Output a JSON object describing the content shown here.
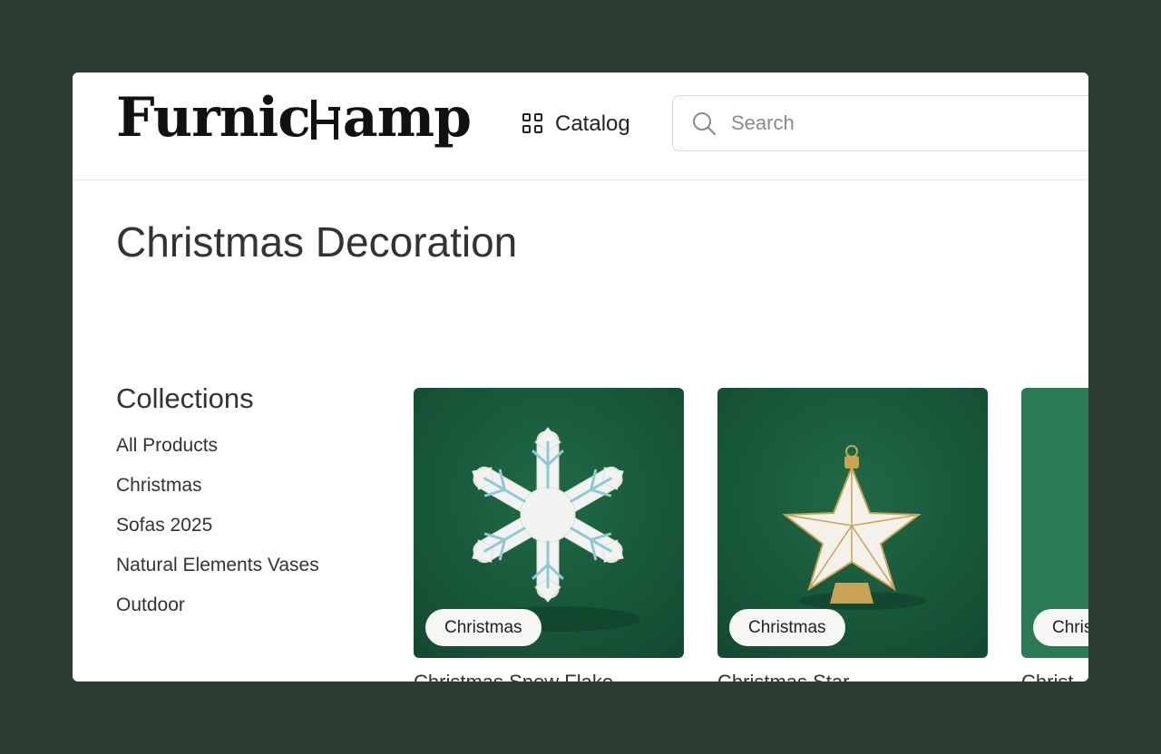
{
  "header": {
    "logo_text_left": "Furnic",
    "logo_text_right": "amp",
    "catalog_label": "Catalog",
    "search_placeholder": "Search"
  },
  "page": {
    "title": "Christmas Decoration"
  },
  "sidebar": {
    "title": "Collections",
    "items": [
      {
        "label": "All Products"
      },
      {
        "label": "Christmas"
      },
      {
        "label": "Sofas 2025"
      },
      {
        "label": "Natural Elements Vases"
      },
      {
        "label": "Outdoor"
      }
    ]
  },
  "products": [
    {
      "badge": "Christmas",
      "title": "Christmas Snow Flake",
      "image": "snowflake-ornament"
    },
    {
      "badge": "Christmas",
      "title": "Christmas Star",
      "image": "star-ornament"
    },
    {
      "badge": "Christmas",
      "title": "Christ",
      "image": "ornament"
    }
  ],
  "colors": {
    "backdrop": "#2c3c32",
    "card_green": "#1a5c3d",
    "badge_bg": "#f6f6f4"
  }
}
